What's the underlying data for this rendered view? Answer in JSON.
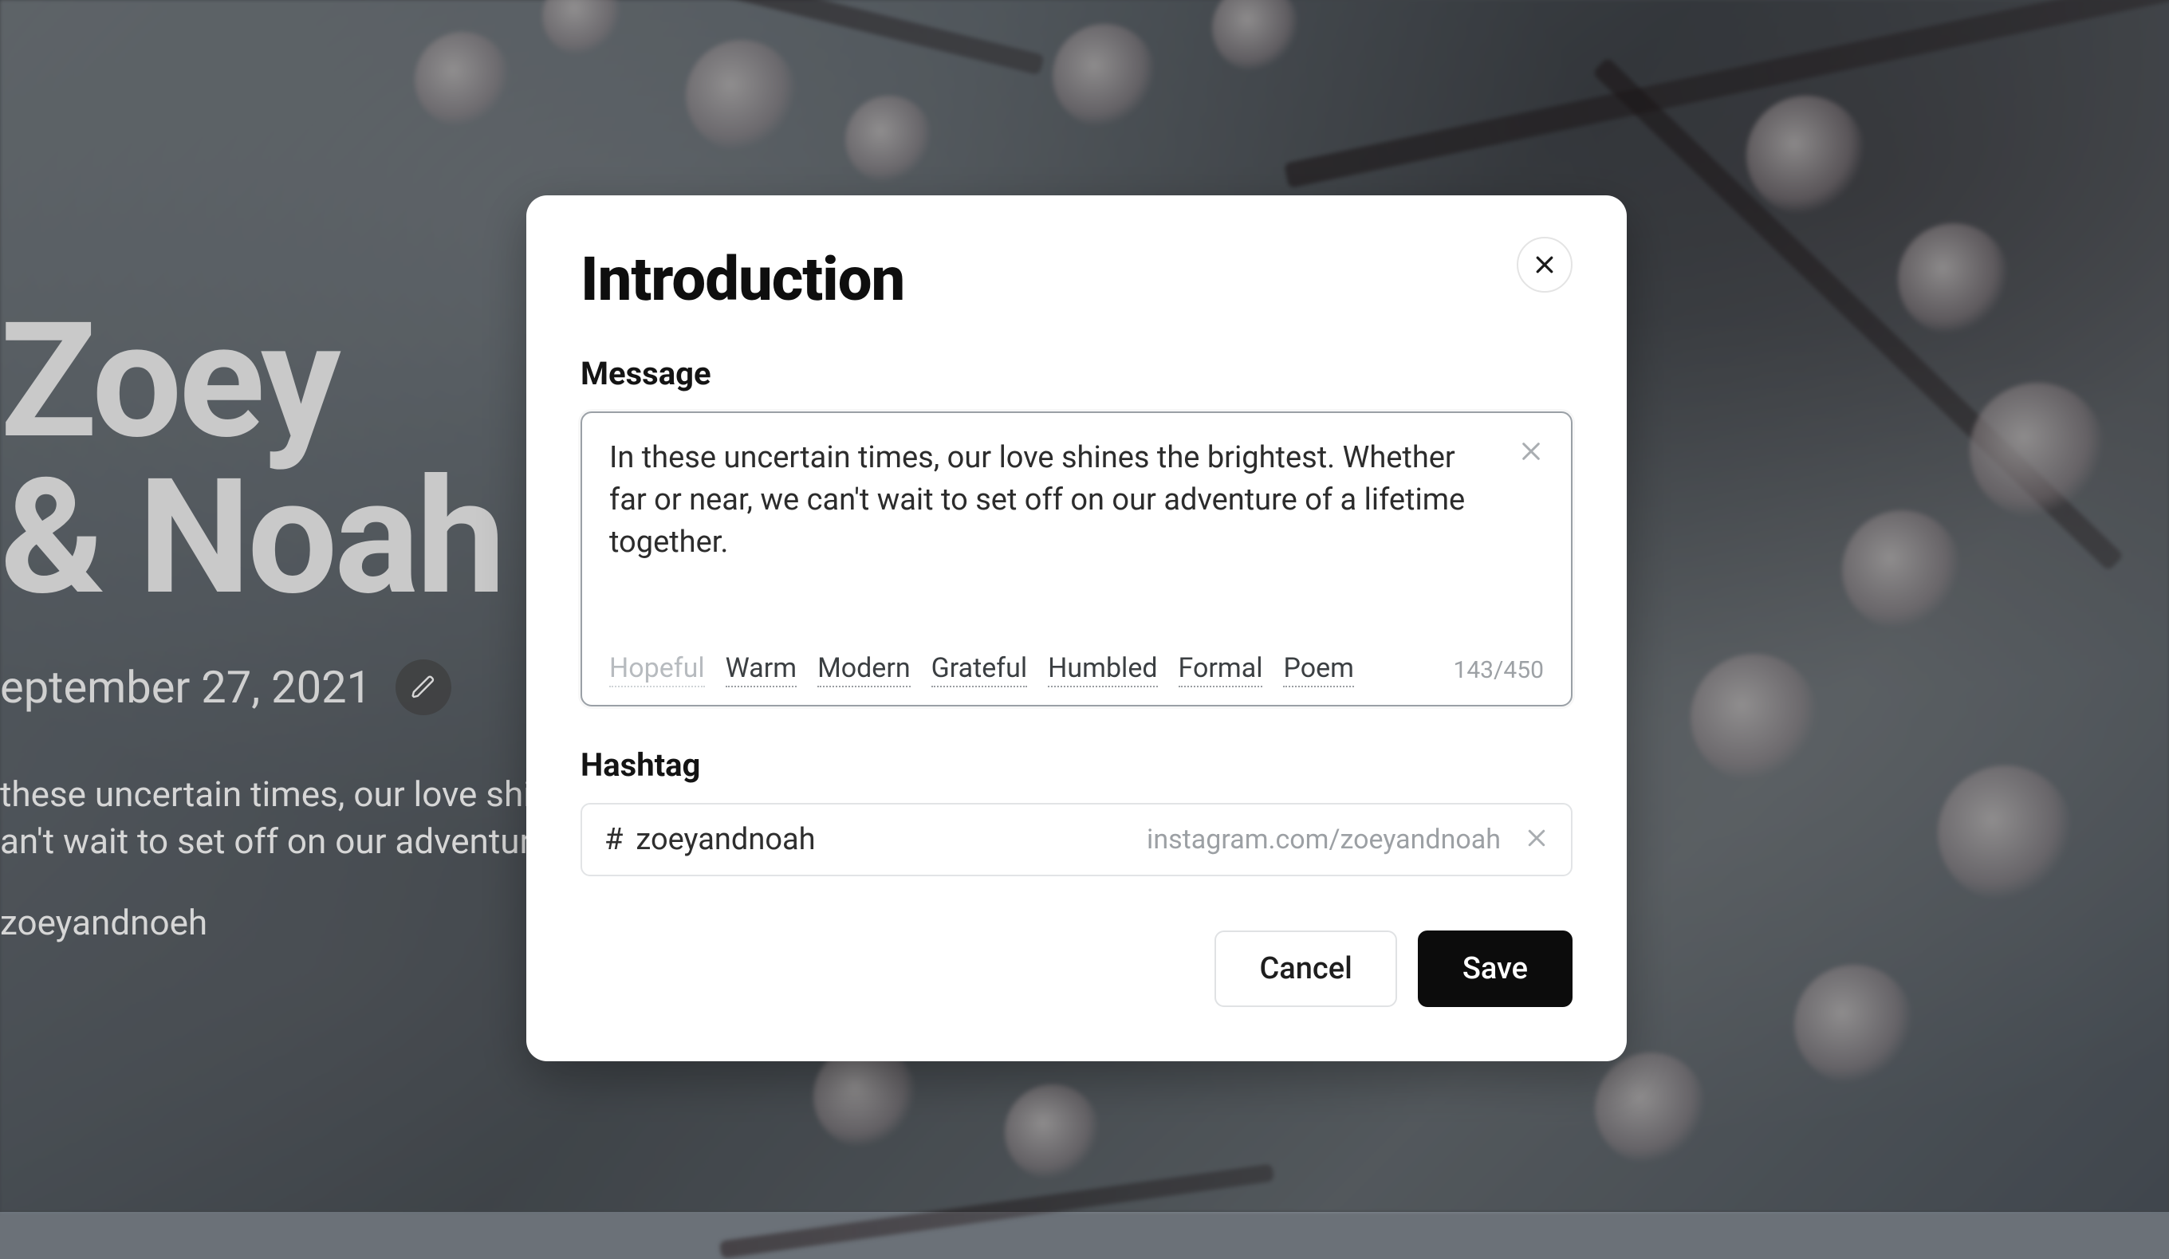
{
  "hero": {
    "name_line1": "Zoey",
    "name_line2": "& Noah",
    "date": "eptember 27, 2021",
    "desc_line1": "these uncertain times, our love shines",
    "desc_line2": "an't wait to set off on our adventure of a",
    "hashtag": "zoeyandnoeh"
  },
  "modal": {
    "title": "Introduction",
    "message_label": "Message",
    "message_value": "In these uncertain times, our love shines the brightest. Whether far or near, we can't wait to set off on our adventure of a lifetime together.",
    "tones": [
      "Hopeful",
      "Warm",
      "Modern",
      "Grateful",
      "Humbled",
      "Formal",
      "Poem"
    ],
    "active_tone_index": 0,
    "char_count": "143/450",
    "hashtag_label": "Hashtag",
    "hashtag_symbol": "#",
    "hashtag_value": "zoeyandnoah",
    "hashtag_url": "instagram.com/zoeyandnoah",
    "cancel": "Cancel",
    "save": "Save"
  }
}
